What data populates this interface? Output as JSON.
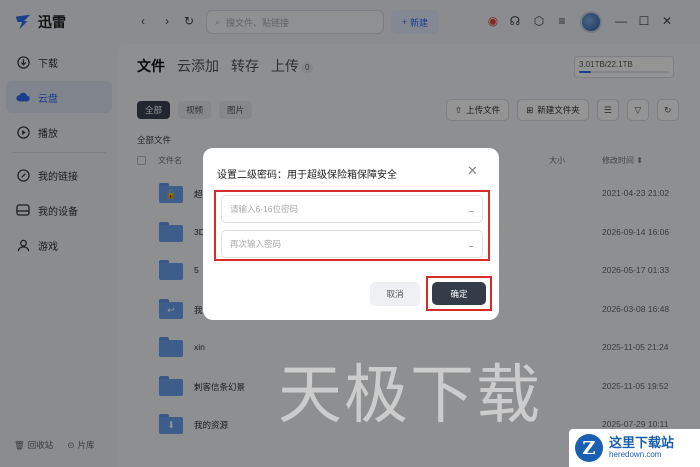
{
  "app": {
    "name": "迅雷"
  },
  "sidebar": {
    "items": [
      {
        "label": "下载",
        "icon": "download-icon",
        "active": false
      },
      {
        "label": "云盘",
        "icon": "cloud-icon",
        "active": true
      },
      {
        "label": "播放",
        "icon": "play-icon",
        "active": false
      },
      {
        "label": "我的链接",
        "icon": "link-icon",
        "active": false
      },
      {
        "label": "我的设备",
        "icon": "device-icon",
        "active": false
      },
      {
        "label": "游戏",
        "icon": "game-icon",
        "active": false
      }
    ],
    "bottom": {
      "recycle": "回收站",
      "library": "片库"
    }
  },
  "topbar": {
    "search_placeholder": "搜文件、贴链接",
    "new_label": "新建"
  },
  "content": {
    "tabs": [
      {
        "label": "文件",
        "active": true
      },
      {
        "label": "云添加",
        "active": false
      },
      {
        "label": "转存",
        "active": false
      },
      {
        "label": "上传",
        "active": false,
        "badge": "0"
      }
    ],
    "storage": {
      "text": "3.01TB/22.1TB",
      "used_fraction": 0.136
    },
    "filters": [
      "全部",
      "视频",
      "图片"
    ],
    "actions": {
      "upload": "上传文件",
      "new_folder": "新建文件夹"
    },
    "all_files_label": "全部文件",
    "table": {
      "col_name": "文件名",
      "col_size": "大小",
      "col_time": "修改时间",
      "rows": [
        {
          "name": "超",
          "time": "2021-04-23 21:02",
          "glyph": "lock"
        },
        {
          "name": "3D",
          "time": "2026-09-14 16:06",
          "glyph": ""
        },
        {
          "name": "5",
          "time": "2026-05-17 01:33",
          "glyph": ""
        },
        {
          "name": "我",
          "time": "2026-03-08 16:48",
          "glyph": "share"
        },
        {
          "name": "xin",
          "time": "2025-11-05 21:24",
          "glyph": ""
        },
        {
          "name": "刺客信条幻景",
          "time": "2025-11-05 19:52",
          "glyph": ""
        },
        {
          "name": "我的资源",
          "time": "2025-07-29 10:11",
          "glyph": "down"
        }
      ]
    }
  },
  "dialog": {
    "title": "设置二级密码：用于超级保险箱保障安全",
    "password_placeholder": "请输入6-16位密码",
    "confirm_placeholder": "再次输入密码",
    "cancel_label": "取消",
    "confirm_label": "确定",
    "highlight_color": "#d82b2b"
  },
  "watermark": {
    "text": "天极下载"
  },
  "site_logo": {
    "letter": "Z",
    "name": "这里下载站",
    "url": "heredown.com"
  }
}
